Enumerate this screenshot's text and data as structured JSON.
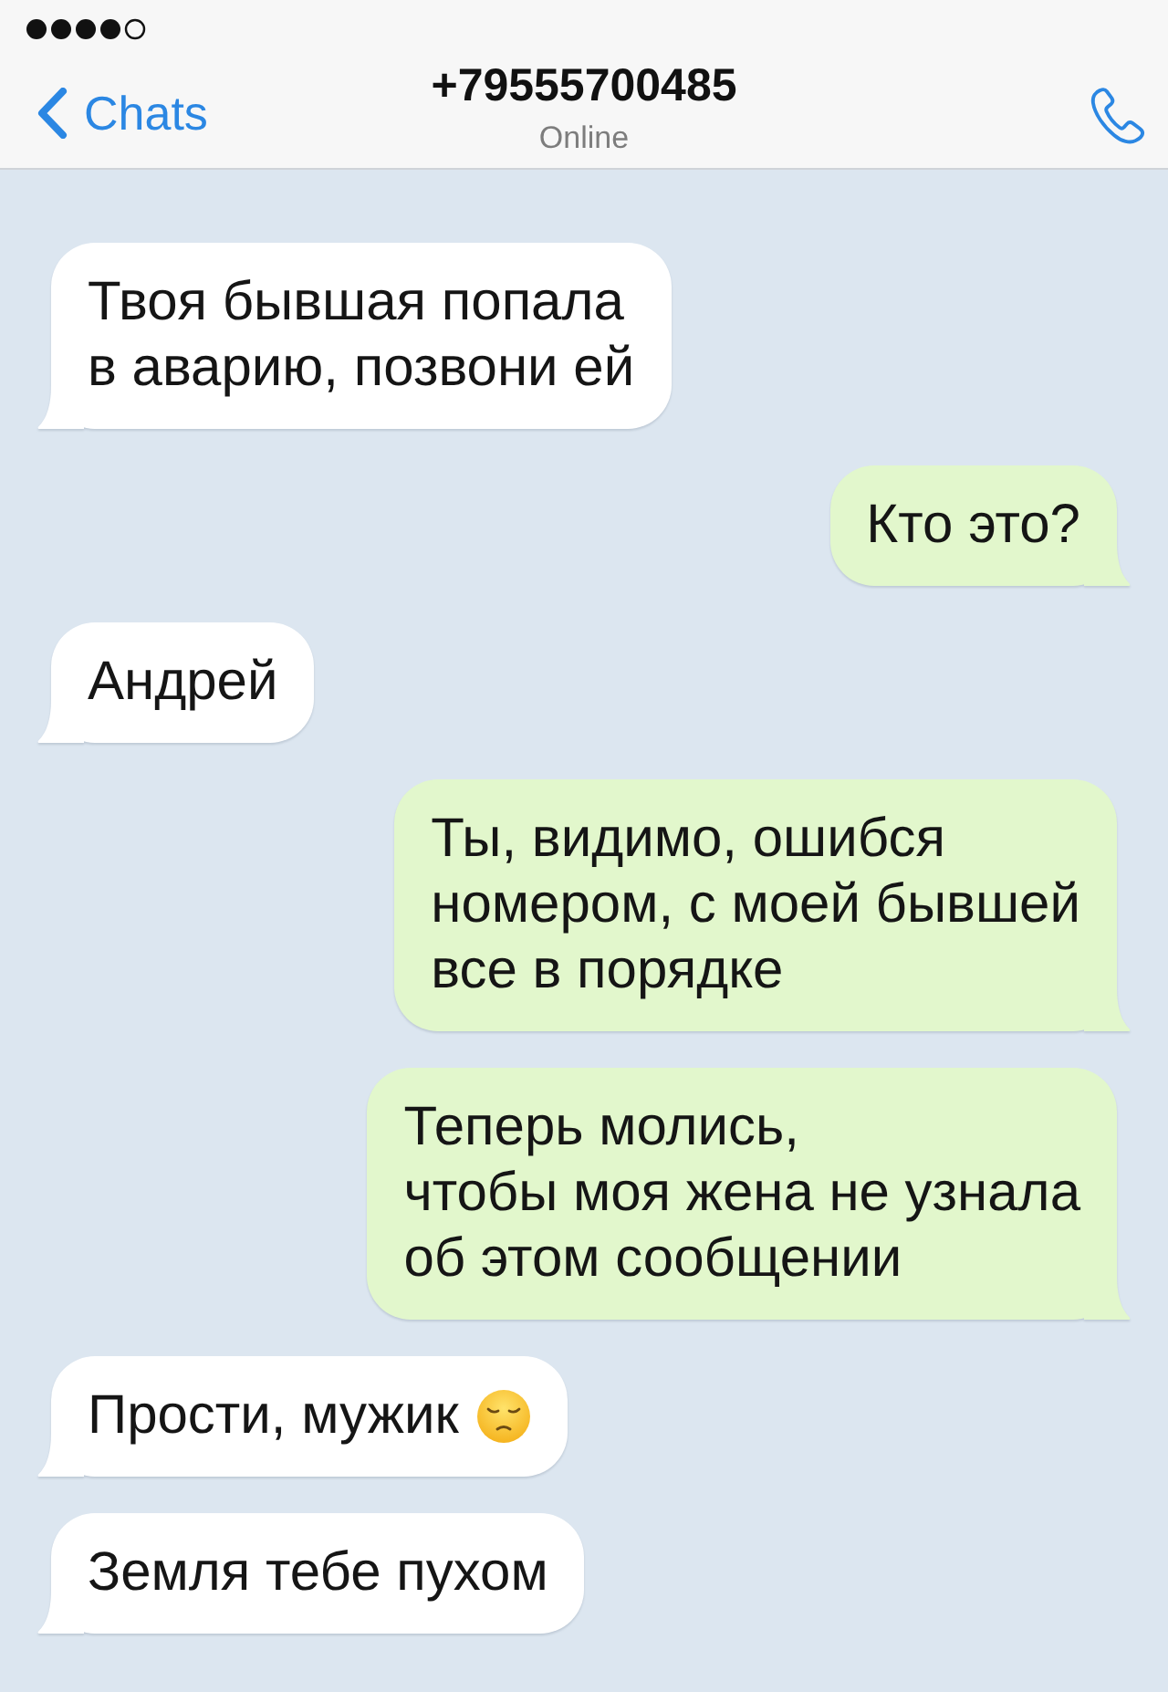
{
  "header": {
    "back_label": "Chats",
    "title": "+79555700485",
    "status": "Online"
  },
  "messages": [
    {
      "kind": "incoming",
      "text": "Твоя бывшая попала\nв аварию, позвони ей",
      "emoji": false
    },
    {
      "kind": "outgoing",
      "text": "Кто это?",
      "emoji": false
    },
    {
      "kind": "incoming",
      "text": "Андрей",
      "emoji": false
    },
    {
      "kind": "outgoing",
      "text": "Ты, видимо, ошибся\nномером, с моей бывшей\nвсе в порядке",
      "emoji": false
    },
    {
      "kind": "outgoing",
      "text": "Теперь молись,\nчтобы моя жена не узнала\nоб этом сообщении",
      "emoji": false
    },
    {
      "kind": "incoming",
      "text": "Прости, мужик",
      "emoji": true
    },
    {
      "kind": "incoming",
      "text": "Земля тебе пухом",
      "emoji": false
    }
  ]
}
